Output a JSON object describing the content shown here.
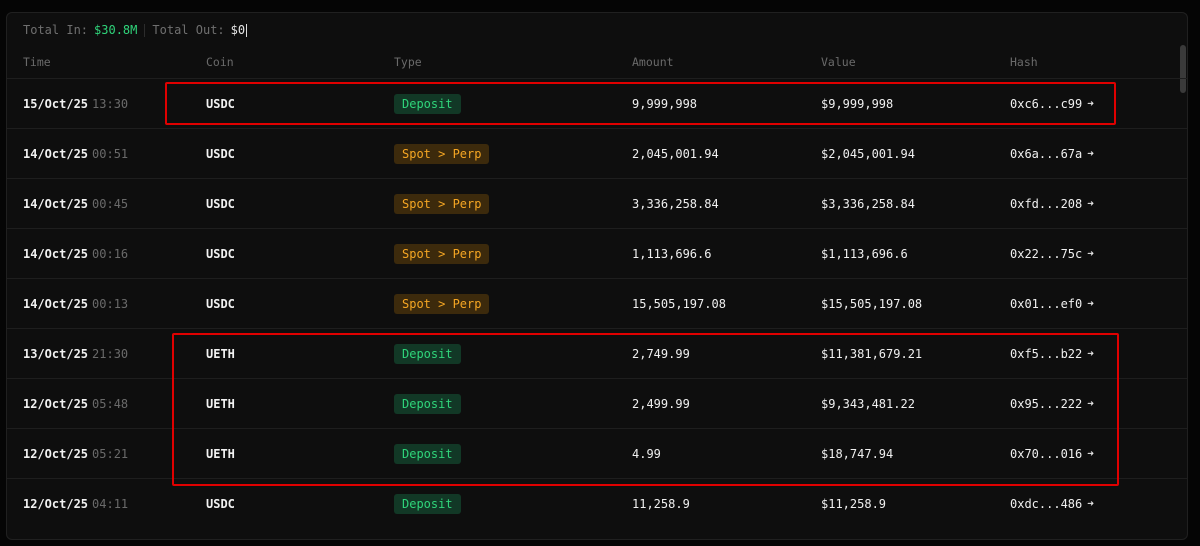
{
  "summary": {
    "total_in_label": "Total In:",
    "total_in_value": "$30.8M",
    "total_out_label": "Total Out:",
    "total_out_value": "$0"
  },
  "columns": {
    "time": "Time",
    "coin": "Coin",
    "type": "Type",
    "amount": "Amount",
    "value": "Value",
    "hash": "Hash"
  },
  "rows": [
    {
      "date": "15/Oct/25",
      "time": "13:30",
      "coin": "USDC",
      "type": "Deposit",
      "type_kind": "deposit",
      "amount": "9,999,998",
      "value": "$9,999,998",
      "hash": "0xc6...c99"
    },
    {
      "date": "14/Oct/25",
      "time": "00:51",
      "coin": "USDC",
      "type": "Spot > Perp",
      "type_kind": "spot",
      "amount": "2,045,001.94",
      "value": "$2,045,001.94",
      "hash": "0x6a...67a"
    },
    {
      "date": "14/Oct/25",
      "time": "00:45",
      "coin": "USDC",
      "type": "Spot > Perp",
      "type_kind": "spot",
      "amount": "3,336,258.84",
      "value": "$3,336,258.84",
      "hash": "0xfd...208"
    },
    {
      "date": "14/Oct/25",
      "time": "00:16",
      "coin": "USDC",
      "type": "Spot > Perp",
      "type_kind": "spot",
      "amount": "1,113,696.6",
      "value": "$1,113,696.6",
      "hash": "0x22...75c"
    },
    {
      "date": "14/Oct/25",
      "time": "00:13",
      "coin": "USDC",
      "type": "Spot > Perp",
      "type_kind": "spot",
      "amount": "15,505,197.08",
      "value": "$15,505,197.08",
      "hash": "0x01...ef0"
    },
    {
      "date": "13/Oct/25",
      "time": "21:30",
      "coin": "UETH",
      "type": "Deposit",
      "type_kind": "deposit",
      "amount": "2,749.99",
      "value": "$11,381,679.21",
      "hash": "0xf5...b22"
    },
    {
      "date": "12/Oct/25",
      "time": "05:48",
      "coin": "UETH",
      "type": "Deposit",
      "type_kind": "deposit",
      "amount": "2,499.99",
      "value": "$9,343,481.22",
      "hash": "0x95...222"
    },
    {
      "date": "12/Oct/25",
      "time": "05:21",
      "coin": "UETH",
      "type": "Deposit",
      "type_kind": "deposit",
      "amount": "4.99",
      "value": "$18,747.94",
      "hash": "0x70...016"
    },
    {
      "date": "12/Oct/25",
      "time": "04:11",
      "coin": "USDC",
      "type": "Deposit",
      "type_kind": "deposit",
      "amount": "11,258.9",
      "value": "$11,258.9",
      "hash": "0xdc...486"
    }
  ],
  "icons": {
    "hash_link": "arrow-right-icon"
  },
  "colors": {
    "deposit_text": "#2fd47a",
    "deposit_bg": "#123826",
    "spot_text": "#f5a623",
    "spot_bg": "#3c2a0c",
    "highlight": "#e00000"
  }
}
